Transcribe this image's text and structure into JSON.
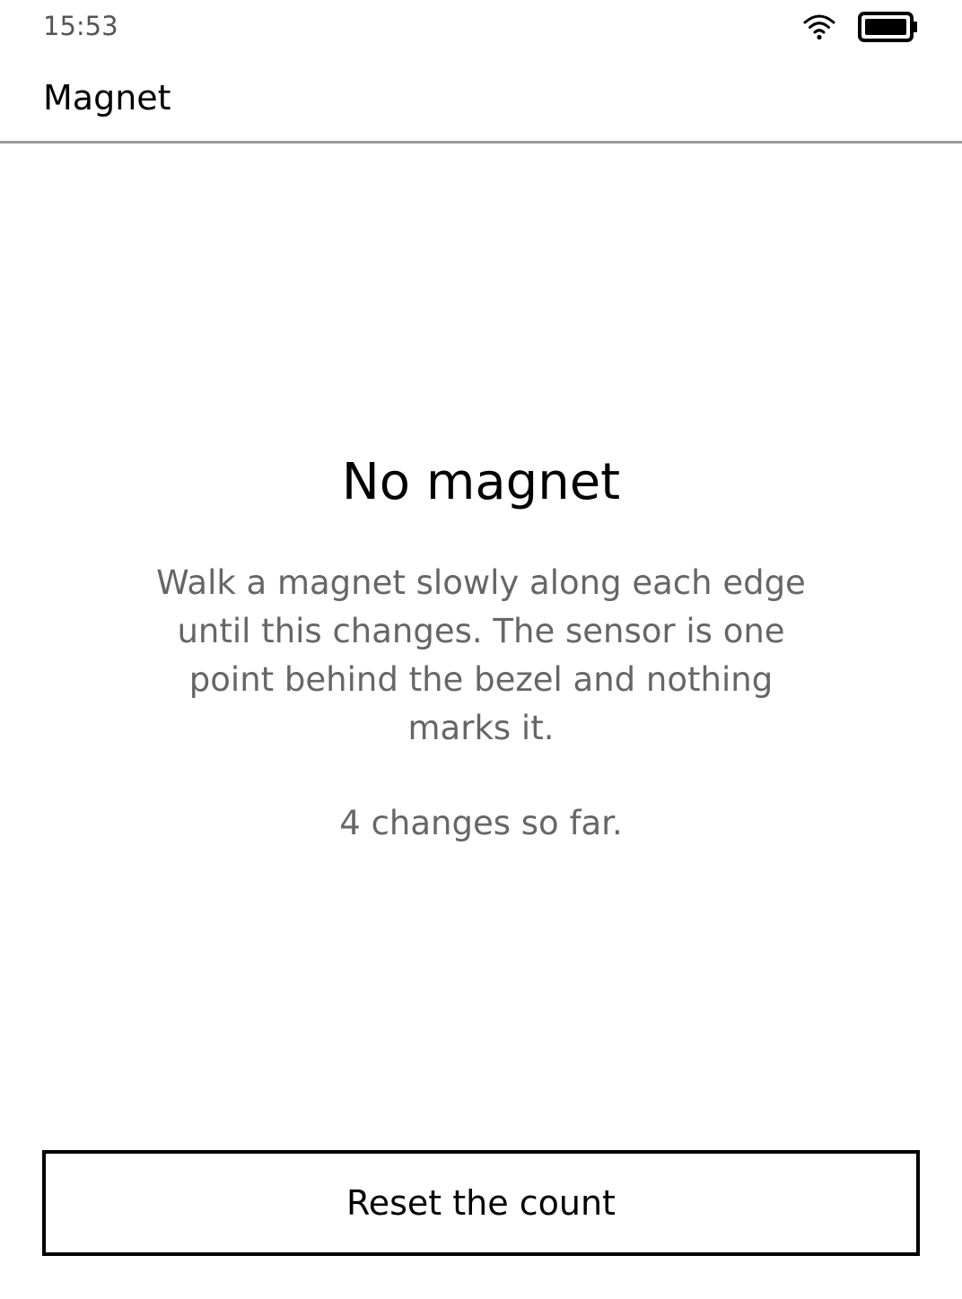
{
  "status_bar": {
    "time": "15:53",
    "wifi_icon": "wifi-icon",
    "battery_icon": "battery-full-icon"
  },
  "header": {
    "title": "Magnet"
  },
  "main": {
    "heading": "No magnet",
    "instructions": "Walk a magnet slowly along each edge until this changes. The sensor is one point behind the bezel and nothing marks it.",
    "count_text": "4 changes so far."
  },
  "actions": {
    "reset_label": "Reset the count"
  },
  "colors": {
    "text_primary": "#000000",
    "text_secondary": "#666666",
    "divider": "#9a9a9a",
    "background": "#ffffff"
  }
}
